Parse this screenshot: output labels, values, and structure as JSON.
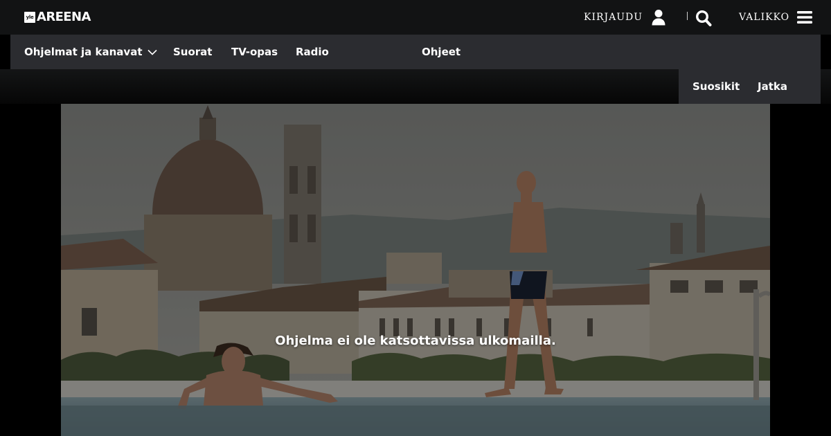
{
  "header": {
    "logo": {
      "badge_text": "yle",
      "brand": "AREENA"
    },
    "login_label": "KIRJAUDU",
    "login_icon": "user-icon",
    "search_icon": "search-icon",
    "menu_label": "VALIKKO",
    "menu_icon": "hamburger-menu-icon"
  },
  "nav": {
    "items": [
      {
        "label": "Ohjelmat ja kanavat",
        "has_dropdown": true
      },
      {
        "label": "Suorat"
      },
      {
        "label": "TV-opas"
      },
      {
        "label": "Radio"
      },
      {
        "label": "Ohjeet"
      }
    ],
    "secondary": [
      {
        "label": "Suosikit"
      },
      {
        "label": "Jatka"
      }
    ]
  },
  "hero": {
    "message": "Ohjelma ei ole katsottavissa ulkomailla."
  },
  "colors": {
    "topbar_bg": "#121314",
    "navbar_bg": "#2b2c30",
    "page_bg": "#000000",
    "text": "#ffffff"
  }
}
